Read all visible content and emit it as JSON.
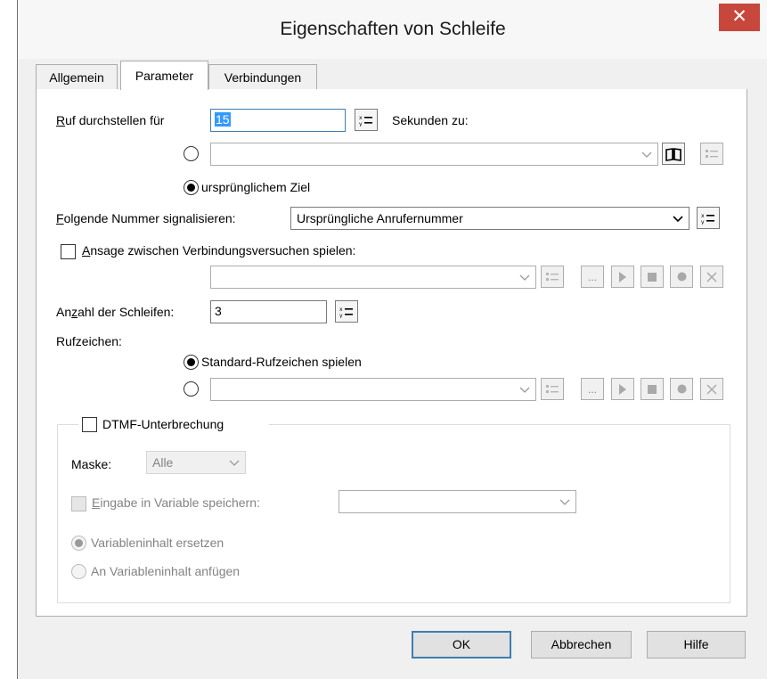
{
  "window": {
    "title": "Eigenschaften von Schleife",
    "close_glyph": "✕"
  },
  "tabs": [
    {
      "label": "Allgemein"
    },
    {
      "label": "Parameter"
    },
    {
      "label": "Verbindungen"
    }
  ],
  "forward": {
    "label_u": "R",
    "label_rest": "uf durchstellen für",
    "seconds_value": "15",
    "seconds_suffix": "Sekunden zu:",
    "target_combo_value": "",
    "radio_original_label": "ursprünglichem Ziel"
  },
  "signal_number": {
    "label_u": "F",
    "label_rest": "olgende Nummer signalisieren:",
    "value": "Ursprüngliche Anrufernummer"
  },
  "announcement": {
    "label_u": "A",
    "label_rest": "nsage zwischen Verbindungsversuchen spielen:",
    "ellipsis": "..."
  },
  "loops": {
    "label_a": "An",
    "label_u": "z",
    "label_b": "ahl der Schleifen:",
    "value": "3"
  },
  "ringtone": {
    "label": "Rufzeichen:",
    "radio_standard_label": "Standard-Rufzeichen spielen",
    "ellipsis": "..."
  },
  "dtmf": {
    "group_label": "DTMF-Unterbrechung",
    "mask_label": "Maske:",
    "mask_value": "Alle",
    "store_label_u": "E",
    "store_label_rest": "ingabe in Variable speichern:",
    "radio_replace_label": "Variableninhalt ersetzen",
    "radio_append_label": "An Variableninhalt anfügen"
  },
  "buttons": {
    "ok": "OK",
    "cancel": "Abbrechen",
    "help": "Hilfe"
  },
  "colors": {
    "accent": "#3c7fb1",
    "close_bg": "#c7473c",
    "selection": "#3399ff"
  }
}
